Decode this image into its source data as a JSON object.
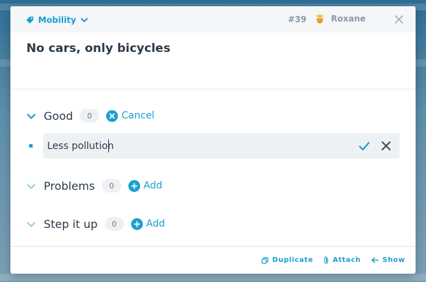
{
  "card": {
    "category": "Mobility",
    "number": "#39",
    "user": "Roxane",
    "title": "No cars, only bicycles"
  },
  "sections": {
    "good": {
      "label": "Good",
      "count": "0",
      "action": "Cancel"
    },
    "problems": {
      "label": "Problems",
      "count": "0",
      "action": "Add"
    },
    "step": {
      "label": "Step it up",
      "count": "0",
      "action": "Add"
    }
  },
  "editing_item": {
    "value": "Less pollution"
  },
  "footer": {
    "duplicate": "Duplicate",
    "attach": "Attach",
    "show": "Show"
  },
  "colors": {
    "accent": "#1aa0cf",
    "text": "#2b3a48",
    "muted": "#8b98a5",
    "badge_bg": "#eef1f4"
  }
}
